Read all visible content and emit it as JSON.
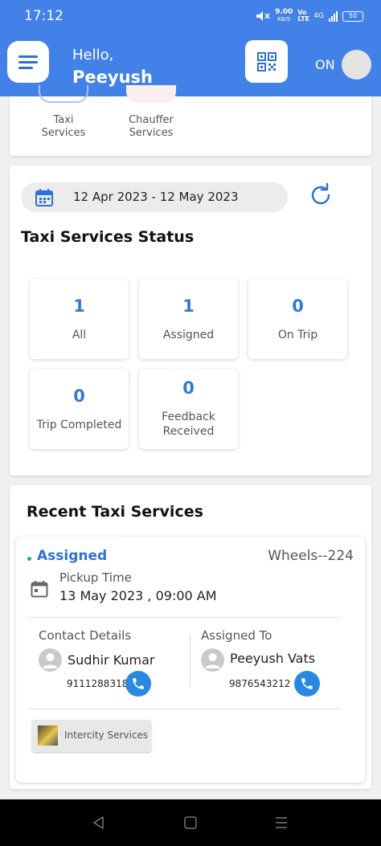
{
  "status_bar": {
    "time": "17:12",
    "net_speed_value": "9.00",
    "net_speed_unit": "KB/S",
    "volte": "Vo LTE",
    "network": "4G",
    "battery": "50"
  },
  "header": {
    "greeting": "Hello,",
    "user_name": "Peeyush",
    "toggle_label": "ON",
    "menu_icon": "hamburger-icon",
    "qr_icon": "qr-code-icon",
    "accent_color": "#4181e8"
  },
  "services": [
    {
      "label_line1": "Taxi",
      "label_line2": "Services"
    },
    {
      "label_line1": "Chauffer",
      "label_line2": "Services"
    }
  ],
  "status_section": {
    "date_range": "12 Apr 2023 - 12 May 2023",
    "title": "Taxi Services Status",
    "tiles": [
      {
        "count": "1",
        "label": "All"
      },
      {
        "count": "1",
        "label": "Assigned"
      },
      {
        "count": "0",
        "label": "On Trip"
      },
      {
        "count": "0",
        "label": "Trip Completed"
      },
      {
        "count": "0",
        "label_line1": "Feedback",
        "label_line2": "Received"
      }
    ]
  },
  "recent": {
    "title": "Recent Taxi Services",
    "ride": {
      "status": "Assigned",
      "status_color": "#1fb08f",
      "vehicle": "Wheels--224",
      "pickup_label": "Pickup Time",
      "pickup_time": "13 May 2023 , 09:00 AM",
      "contact_heading": "Contact Details",
      "contact_name": "Sudhir Kumar",
      "contact_phone": "9111288318",
      "assigned_heading": "Assigned To",
      "assigned_name": "Peeyush Vats",
      "assigned_phone": "9876543212",
      "service_type": "Intercity Services"
    }
  }
}
